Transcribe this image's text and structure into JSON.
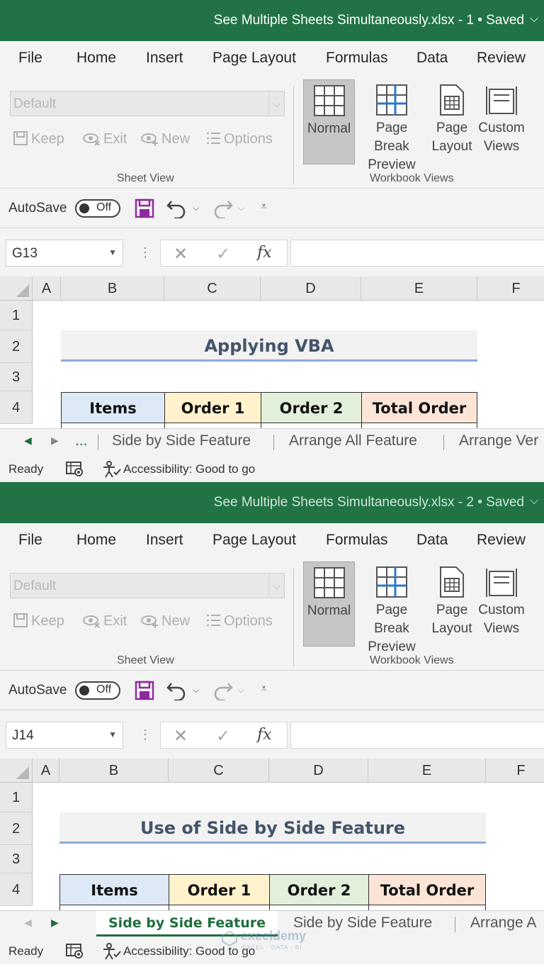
{
  "menu": [
    "File",
    "Home",
    "Insert",
    "Page Layout",
    "Formulas",
    "Data",
    "Review"
  ],
  "sheet_view": {
    "select_value": "Default",
    "buttons": [
      "Keep",
      "Exit",
      "New",
      "Options"
    ],
    "group_label": "Sheet View"
  },
  "workbook_views": {
    "normal": "Normal",
    "page_break_1": "Page Break",
    "page_break_2": "Preview",
    "page_layout_1": "Page",
    "page_layout_2": "Layout",
    "custom_1": "Custom",
    "custom_2": "Views",
    "group_label": "Workbook Views"
  },
  "qat": {
    "autosave_label": "AutoSave",
    "toggle_state": "Off"
  },
  "formula_bar": {
    "fx": "fx"
  },
  "columns": [
    "A",
    "B",
    "C",
    "D",
    "E",
    "F"
  ],
  "rows": [
    "1",
    "2",
    "3",
    "4"
  ],
  "table_headers": [
    "Items",
    "Order 1",
    "Order 2",
    "Total Order"
  ],
  "status": {
    "ready": "Ready",
    "accessibility": "Accessibility: Good to go"
  },
  "colors": {
    "title_green": "#217346",
    "items_fill": "#dde9f7",
    "order1_fill": "#fff2cc",
    "order2_fill": "#e2efda",
    "total_fill": "#fce4d6",
    "title_text": "#44546a",
    "title_underline": "#8eaadb"
  },
  "window1": {
    "title": "See Multiple Sheets Simultaneously.xlsx  -  1 • Saved",
    "namebox": "G13",
    "sheet_title": "Applying VBA",
    "tabs": [
      "...",
      "Side by Side Feature",
      "Arrange All Feature",
      "Arrange Ver"
    ]
  },
  "window2": {
    "title": "See Multiple Sheets Simultaneously.xlsx  -  2 • Saved",
    "namebox": "J14",
    "sheet_title": "Use of Side by Side Feature",
    "tabs": [
      "Side by Side Feature",
      "Side by Side Feature",
      "Arrange A"
    ]
  },
  "watermark": {
    "name": "exceldemy",
    "sub": "EXCEL · DATA · BI"
  }
}
